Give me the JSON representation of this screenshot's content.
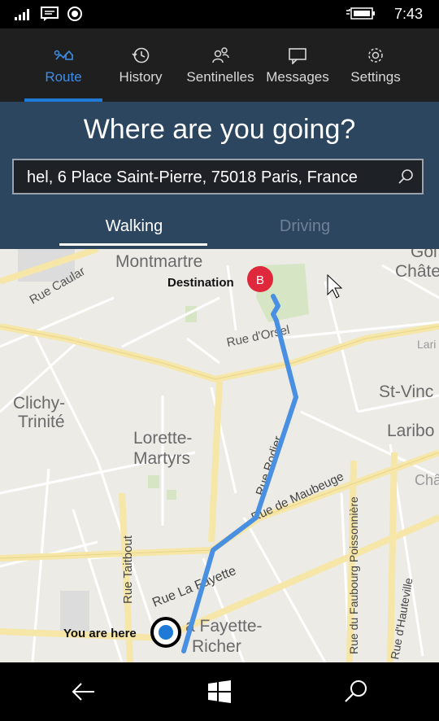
{
  "status_bar": {
    "time": "7:43",
    "icons": [
      "signal-icon",
      "message-icon",
      "location-icon",
      "battery-icon"
    ]
  },
  "nav": {
    "tabs": [
      {
        "label": "Route",
        "icon": "route-icon",
        "active": true
      },
      {
        "label": "History",
        "icon": "history-icon",
        "active": false
      },
      {
        "label": "Sentinelles",
        "icon": "people-icon",
        "active": false
      },
      {
        "label": "Messages",
        "icon": "chat-icon",
        "active": false
      },
      {
        "label": "Settings",
        "icon": "gear-icon",
        "active": false
      }
    ],
    "accent": "#3d8ee8"
  },
  "search": {
    "title": "Where are you going?",
    "value": "hel, 6 Place Saint-Pierre, 75018 Paris, France",
    "icon": "search-icon"
  },
  "modes": {
    "walking": "Walking",
    "driving": "Driving",
    "selected": "Walking"
  },
  "map": {
    "labels": {
      "montmartre": "Montmartre",
      "destination": "Destination",
      "marker_b": "B",
      "rue_caulaincourt": "Rue Caular",
      "rue_dorsel": "Rue d'Orsel",
      "clichy_1": "Clichy-",
      "clichy_2": "Trinité",
      "lorette_1": "Lorette-",
      "lorette_2": "Martyrs",
      "rue_rodier": "Rue Rodier",
      "rue_maubeuge": "Rue de Maubeuge",
      "rue_taitbout": "Rue Taitbout",
      "rue_lafayette": "Rue La Fayette",
      "lafayette_1": "a Fayette-",
      "lafayette_2": "Richer",
      "you_are_here": "You are here",
      "faubourg_poissonniere": "Rue du Faubourg Poissonnière",
      "hauteville": "Rue d'Hauteville",
      "goutte_1": "Goi",
      "goutte_2": "Châte",
      "stvincent_1": "St-Vinc",
      "stvincent_2": "Laribo",
      "lari": "Lari",
      "chate2": "Châte"
    },
    "route_color": "#4a90e2",
    "marker_color": "#e0283c"
  },
  "bottom_bar": {
    "icons": [
      "back-arrow-icon",
      "windows-start-icon",
      "search-icon"
    ]
  }
}
